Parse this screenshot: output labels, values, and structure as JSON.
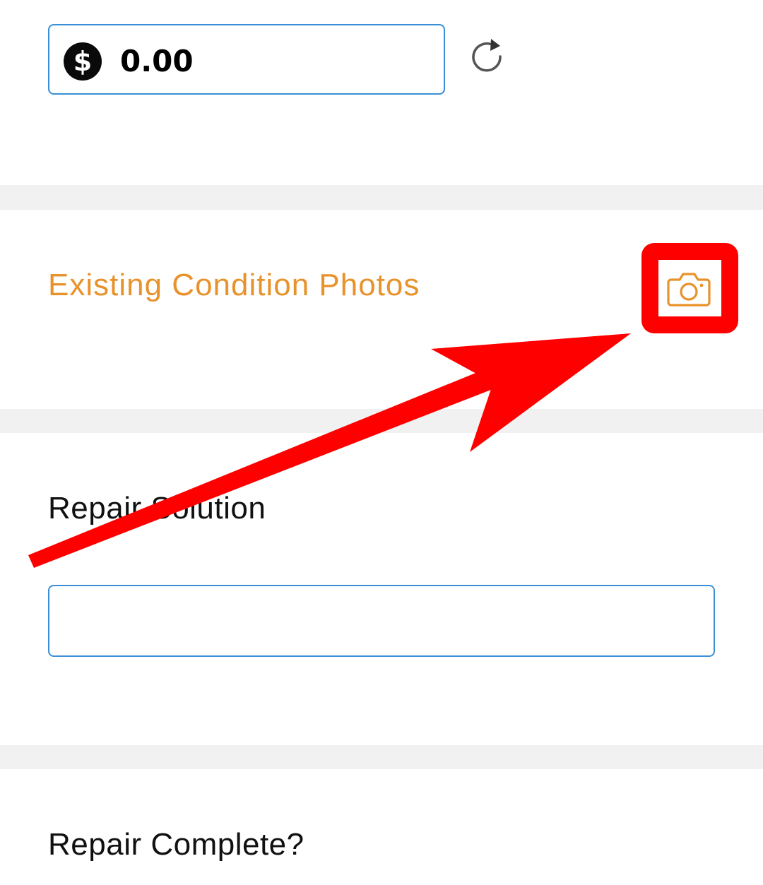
{
  "cost": {
    "currency_icon": "dollar-circle-icon",
    "value": "0.00",
    "reset_icon": "refresh-icon"
  },
  "photos": {
    "title": "Existing Condition Photos",
    "camera_icon": "camera-icon",
    "accent_color": "#e8922b"
  },
  "repair_solution": {
    "label": "Repair Solution",
    "value": ""
  },
  "repair_complete": {
    "label": "Repair Complete?"
  },
  "annotation": {
    "highlight_color": "#ff0000"
  }
}
